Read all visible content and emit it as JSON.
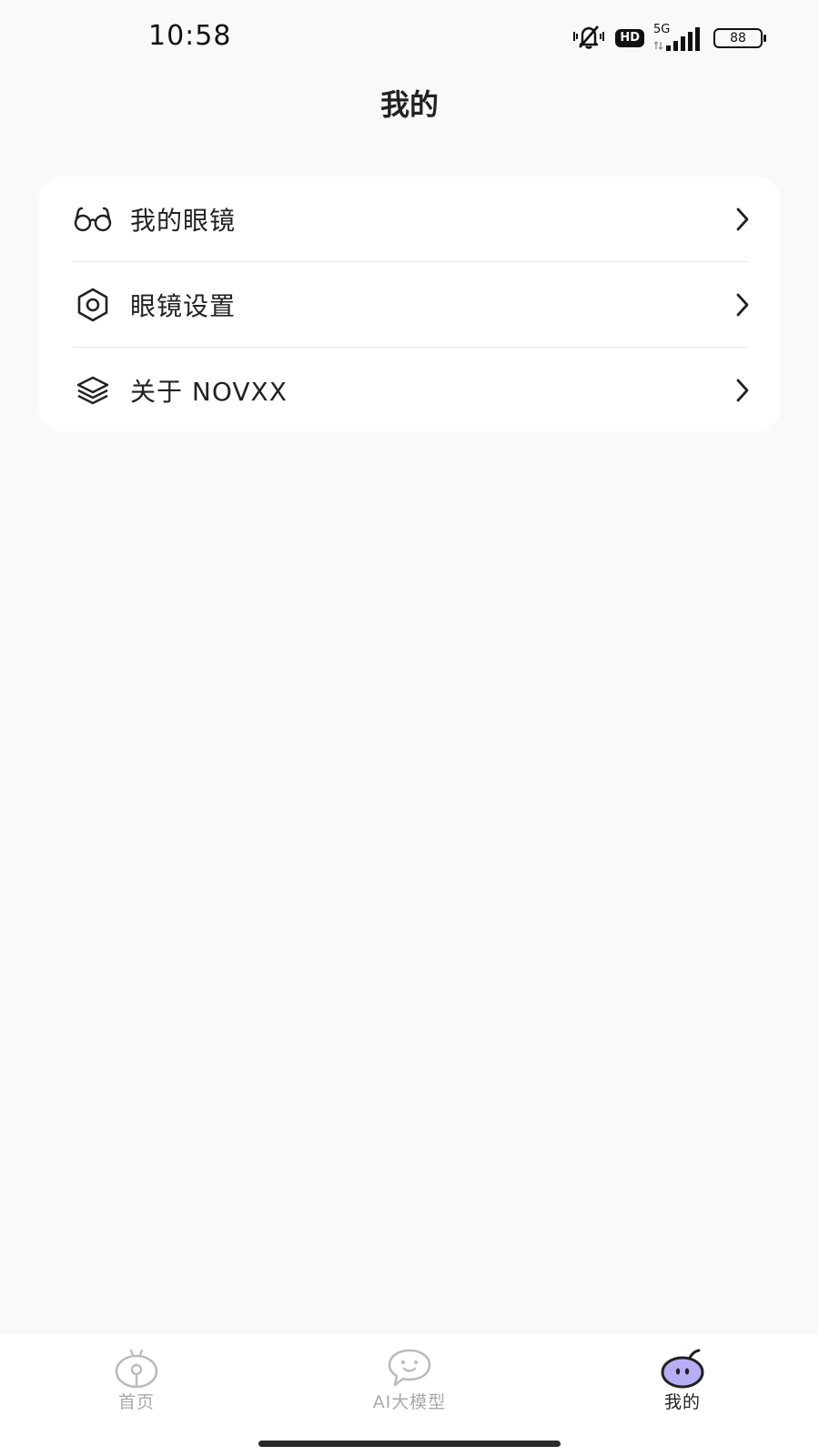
{
  "status_bar": {
    "time": "10:58",
    "network": "5G",
    "hd": "HD",
    "battery": "88",
    "icons": [
      "mute-vibrate-icon",
      "hd-icon",
      "signal-5g-icon",
      "battery-icon"
    ]
  },
  "header": {
    "title": "我的"
  },
  "menu": {
    "items": [
      {
        "label": "我的眼镜",
        "icon": "glasses-icon"
      },
      {
        "label": "眼镜设置",
        "icon": "hex-settings-icon"
      },
      {
        "label": "关于 NOVXX",
        "icon": "layers-icon"
      }
    ]
  },
  "bottom_nav": {
    "items": [
      {
        "label": "首页",
        "icon": "home-mascot-icon",
        "active": false
      },
      {
        "label": "AI大模型",
        "icon": "chat-bubble-icon",
        "active": false
      },
      {
        "label": "我的",
        "icon": "profile-mascot-icon",
        "active": true
      }
    ]
  },
  "colors": {
    "background": "#f9f9f9",
    "card": "#ffffff",
    "text": "#222222",
    "inactive_nav": "#aaaaaa",
    "active_accent": "#a89cf0"
  }
}
